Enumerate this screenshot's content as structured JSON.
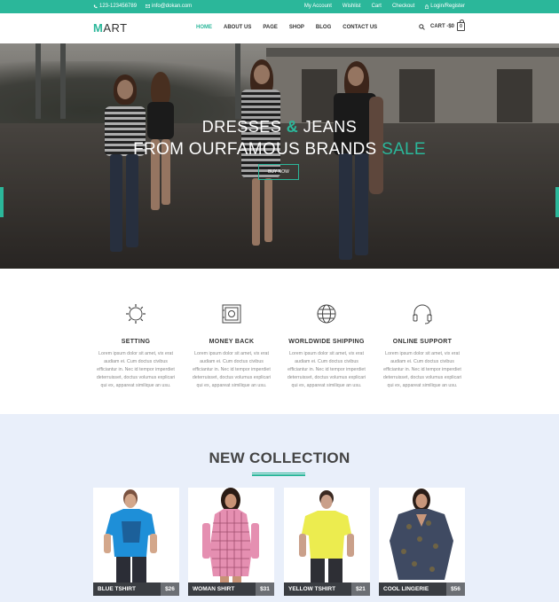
{
  "topbar": {
    "phone": "123-123456789",
    "email": "info@dokan.com",
    "links": [
      "My Account",
      "Wishlist",
      "Cart",
      "Checkout",
      "Login/Register"
    ]
  },
  "header": {
    "logo_first": "M",
    "logo_rest": "ART",
    "nav": [
      "HOME",
      "ABOUT US",
      "PAGE",
      "SHOP",
      "BLOG",
      "CONTACT US"
    ],
    "active_nav": "HOME",
    "cart_label": "CART -$0",
    "cart_count": "0"
  },
  "hero": {
    "line1_a": "DRESSES ",
    "line1_amp": "&",
    "line1_b": " JEANS",
    "line2_a": "FROM OURFAMOUS BRANDS ",
    "line2_sale": "SALE",
    "button": "BUY NOW"
  },
  "features": [
    {
      "icon": "gear-icon",
      "title": "SETTING",
      "desc": "Lorem ipsum dolor sit amet, vix erat audiam ei. Cum doctus civibus efficiantur in. Nec id tempor imperdiet deterruisset, doctus volumus explicari qui ex, appareat similique an usu."
    },
    {
      "icon": "safe-icon",
      "title": "MONEY BACK",
      "desc": "Lorem ipsum dolor sit amet, vix erat audiam ei. Cum doctus civibus efficiantur in. Nec id tempor imperdiet deterruisset, doctus volumus explicari qui ex, appareat similique an usu."
    },
    {
      "icon": "globe-icon",
      "title": "WORLDWIDE SHIPPING",
      "desc": "Lorem ipsum dolor sit amet, vix erat audiam ei. Cum doctus civibus efficiantur in. Nec id tempor imperdiet deterruisset, doctus volumus explicari qui ex, appareat similique an usu."
    },
    {
      "icon": "headset-icon",
      "title": "ONLINE SUPPORT",
      "desc": "Lorem ipsum dolor sit amet, vix erat audiam ei. Cum doctus civibus efficiantur in. Nec id tempor imperdiet deterruisset, doctus volumus explicari qui ex, appareat similique an usu."
    }
  ],
  "collection": {
    "title": "NEW COLLECTION",
    "products": [
      {
        "name": "BLUE TSHIRT",
        "price": "$26"
      },
      {
        "name": "WOMAN SHIRT",
        "price": "$31"
      },
      {
        "name": "YELLOW TSHIRT",
        "price": "$21"
      },
      {
        "name": "COOL LINGERIE",
        "price": "$56"
      }
    ]
  },
  "colors": {
    "accent": "#2bb79a",
    "dark_bar": "#3a3d42",
    "price_bg": "#6c6f74",
    "collection_bg": "#e9effa"
  }
}
